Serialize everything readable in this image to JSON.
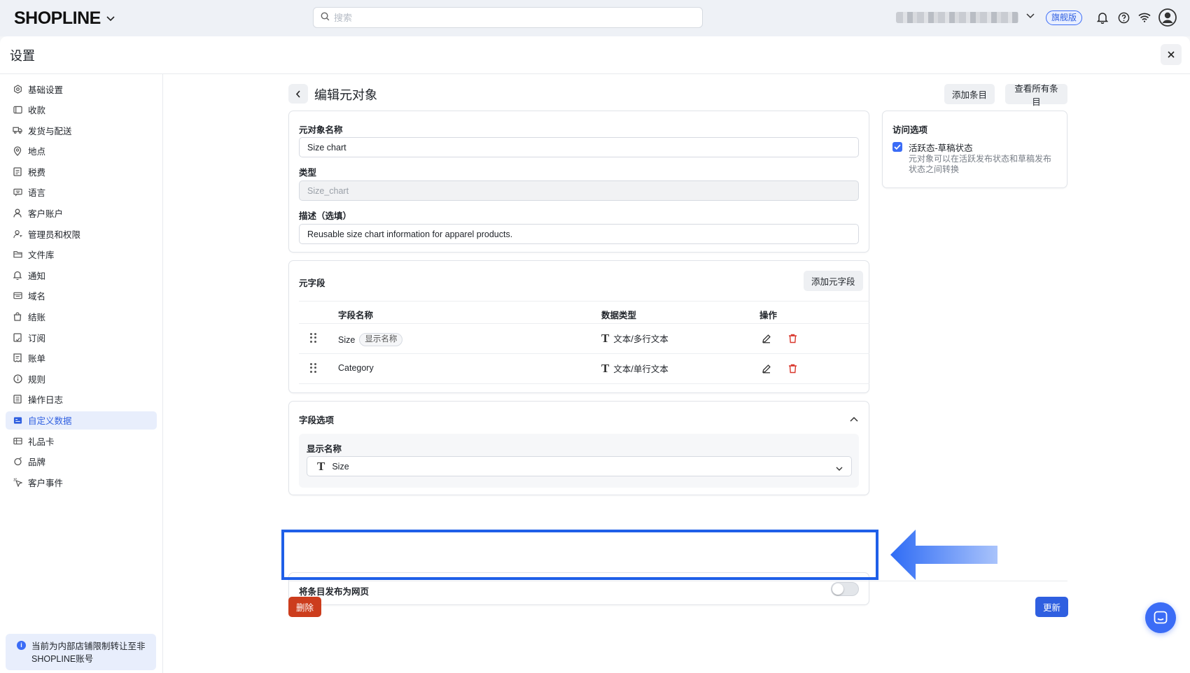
{
  "topbar": {
    "logo": "SHOPLINE",
    "search_placeholder": "搜索",
    "plan_badge": "旗舰版"
  },
  "panel": {
    "title": "设置"
  },
  "sidebar": {
    "items": [
      {
        "label": "基础设置",
        "icon": "gear-icon"
      },
      {
        "label": "收款",
        "icon": "wallet-icon"
      },
      {
        "label": "发货与配送",
        "icon": "truck-icon"
      },
      {
        "label": "地点",
        "icon": "location-pin-icon"
      },
      {
        "label": "税费",
        "icon": "tax-receipt-icon"
      },
      {
        "label": "语言",
        "icon": "language-icon"
      },
      {
        "label": "客户账户",
        "icon": "user-icon"
      },
      {
        "label": "管理员和权限",
        "icon": "user-key-icon"
      },
      {
        "label": "文件库",
        "icon": "folder-icon"
      },
      {
        "label": "通知",
        "icon": "bell-icon"
      },
      {
        "label": "域名",
        "icon": "domain-icon"
      },
      {
        "label": "结账",
        "icon": "shopping-bag-icon"
      },
      {
        "label": "订阅",
        "icon": "subscription-icon"
      },
      {
        "label": "账单",
        "icon": "bill-icon"
      },
      {
        "label": "规则",
        "icon": "info-circle-icon"
      },
      {
        "label": "操作日志",
        "icon": "log-icon"
      },
      {
        "label": "自定义数据",
        "icon": "custom-data-icon",
        "active": true
      },
      {
        "label": "礼品卡",
        "icon": "gift-card-icon"
      },
      {
        "label": "品牌",
        "icon": "brand-icon"
      },
      {
        "label": "客户事件",
        "icon": "cursor-icon"
      }
    ],
    "notice": "当前为内部店铺限制转让至非SHOPLINE账号"
  },
  "page": {
    "title": "编辑元对象",
    "add_entry": "添加条目",
    "view_all_entries": "查看所有条目"
  },
  "basic": {
    "name_label": "元对象名称",
    "name_value": "Size chart",
    "type_label": "类型",
    "type_value": "Size_chart",
    "desc_label": "描述（选填）",
    "desc_value": "Reusable size chart information for apparel products."
  },
  "metafields": {
    "title": "元字段",
    "add_button": "添加元字段",
    "columns": [
      "字段名称",
      "数据类型",
      "操作"
    ],
    "rows": [
      {
        "name": "Size",
        "tag": "显示名称",
        "type": "文本/多行文本"
      },
      {
        "name": "Category",
        "tag": "",
        "type": "文本/单行文本"
      }
    ]
  },
  "field_options": {
    "title": "字段选项",
    "display_name_label": "显示名称",
    "display_name_value": "Size"
  },
  "publish": {
    "label": "将条目发布为网页",
    "enabled": false
  },
  "access": {
    "title": "访问选项",
    "checkbox_label": "活跃态-草稿状态",
    "checkbox_checked": true,
    "checkbox_desc": "元对象可以在活跃发布状态和草稿发布状态之间转换"
  },
  "footer": {
    "delete": "删除",
    "update": "更新"
  },
  "colors": {
    "primary": "#2f5fe0",
    "danger": "#cc3d1d",
    "highlight": "#1f5fe8"
  }
}
